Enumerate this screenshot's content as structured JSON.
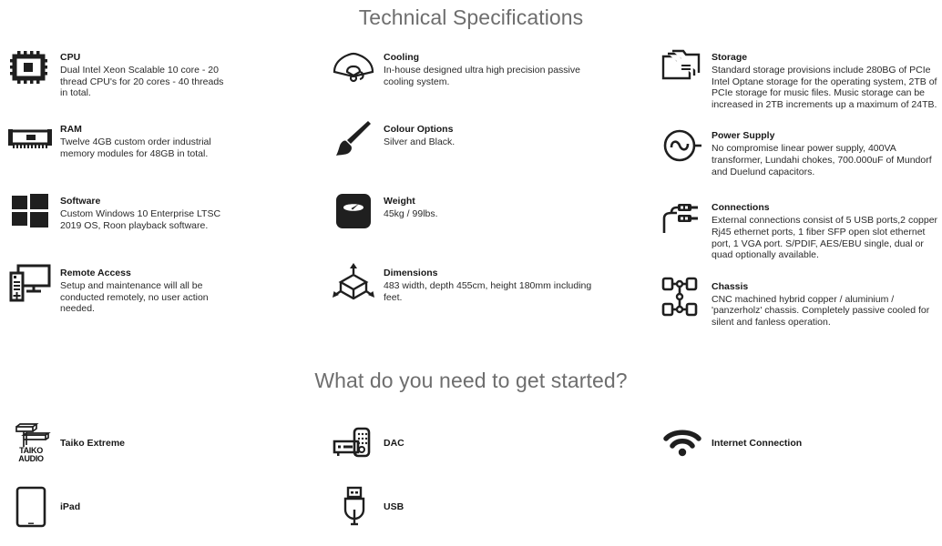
{
  "sections": {
    "specs_title": "Technical Specifications",
    "started_title": "What do you need to get started?"
  },
  "specs": {
    "column1": [
      {
        "icon": "cpu-chip-icon",
        "title": "CPU",
        "desc": "Dual Intel Xeon Scalable 10 core - 20 thread CPU's for 20 cores - 40 threads in total."
      },
      {
        "icon": "ram-module-icon",
        "title": "RAM",
        "desc": "Twelve 4GB custom order industrial memory modules for 48GB in total."
      },
      {
        "icon": "windows-logo-icon",
        "title": "Software",
        "desc": "Custom Windows 10 Enterprise LTSC 2019 OS, Roon playback software."
      },
      {
        "icon": "remote-desktop-icon",
        "title": "Remote Access",
        "desc": "Setup and maintenance will all be conducted remotely, no user action needed."
      }
    ],
    "column2": [
      {
        "icon": "fan-icon",
        "title": "Cooling",
        "desc": "In-house designed ultra high precision passive cooling system."
      },
      {
        "icon": "paintbrush-icon",
        "title": "Colour Options",
        "desc": "Silver and Black."
      },
      {
        "icon": "weight-scale-icon",
        "title": "Weight",
        "desc": "45kg / 99lbs."
      },
      {
        "icon": "cube-dimensions-icon",
        "title": "Dimensions",
        "desc": "483 width, depth 455cm, height 180mm including feet."
      }
    ],
    "column3": [
      {
        "icon": "folders-icon",
        "title": "Storage",
        "desc": "Standard storage provisions include 280BG of PCIe Intel Optane storage for the operating system, 2TB of PCIe storage for music files. Music storage can be increased in 2TB increments up a maximum of 24TB."
      },
      {
        "icon": "ac-power-icon",
        "title": "Power Supply",
        "desc": "No compromise linear power supply, 400VA transformer, Lundahi chokes, 700.000uF of Mundorf and Duelund capacitors."
      },
      {
        "icon": "rca-cables-icon",
        "title": "Connections",
        "desc": "External connections consist of 5 USB ports,2 copper Rj45 ethernet ports, 1 fiber SFP open slot ethernet port, 1 VGA port. S/PDIF, AES/EBU single, dual or quad optionally available."
      },
      {
        "icon": "chassis-frame-icon",
        "title": "Chassis",
        "desc": "CNC machined hybrid copper / aluminium / 'panzerholz' chassis. Completely passive cooled for silent and fanless operation."
      }
    ]
  },
  "requirements": {
    "column1": [
      {
        "icon": "taiko-audio-logo-icon",
        "label": "Taiko Extreme",
        "logo_line1": "TAIKO",
        "logo_line2": "AUDIO"
      },
      {
        "icon": "ipad-tablet-icon",
        "label": "iPad"
      }
    ],
    "column2": [
      {
        "icon": "dac-device-icon",
        "label": "DAC"
      },
      {
        "icon": "usb-connector-icon",
        "label": "USB"
      }
    ],
    "column3": [
      {
        "icon": "wifi-icon",
        "label": "Internet Connection"
      }
    ]
  },
  "colors": {
    "heading": "#6e6e6e",
    "body_text": "#2a2a2a",
    "icon": "#1f1f1f",
    "background": "#ffffff"
  }
}
